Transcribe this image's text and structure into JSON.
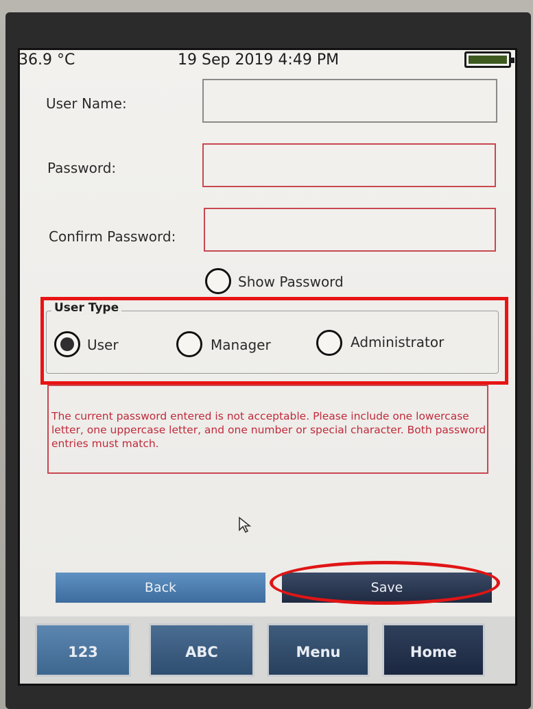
{
  "status_bar": {
    "temperature": "36.9 °C",
    "datetime": "19 Sep 2019 4:49 PM",
    "battery_level": 1.0
  },
  "form": {
    "username_label": "User Name:",
    "username_value": "",
    "password_label": "Password:",
    "password_value": "",
    "confirm_label": "Confirm Password:",
    "confirm_value": "",
    "show_password_label": "Show Password"
  },
  "user_type": {
    "title": "User Type",
    "options": [
      {
        "label": "User",
        "selected": true
      },
      {
        "label": "Manager",
        "selected": false
      },
      {
        "label": "Administrator",
        "selected": false
      }
    ]
  },
  "error_message": "The current password entered is not acceptable. Please include one lowercase letter, one uppercase letter, and one number or special character. Both password entries must match.",
  "buttons": {
    "back": "Back",
    "save": "Save"
  },
  "keys": [
    "123",
    "ABC",
    "Menu",
    "Home"
  ],
  "colors": {
    "error": "#c02a3a",
    "annotation": "#e81414",
    "battery": "#3e5a1f"
  }
}
